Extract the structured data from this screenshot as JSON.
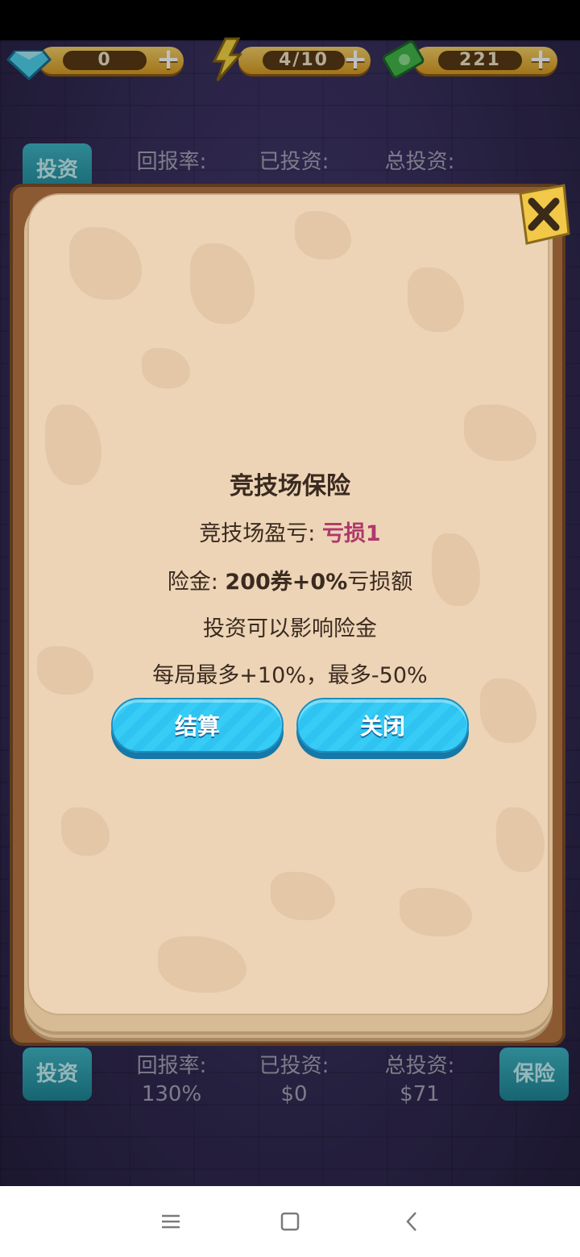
{
  "resources": {
    "gems": "0",
    "energy": "4/10",
    "cash": "221"
  },
  "hud_top": {
    "invest_label": "投资",
    "return_rate_label": "回报率:",
    "invested_label": "已投资:",
    "total_invest_label": "总投资:"
  },
  "hud_bottom": {
    "invest_label": "投资",
    "return_rate_label": "回报率:",
    "return_rate_value": "130%",
    "invested_label": "已投资:",
    "invested_value": "$0",
    "total_invest_label": "总投资:",
    "total_invest_value": "$71",
    "insurance_label": "保险"
  },
  "modal": {
    "title": "竞技场保险",
    "line1_prefix": "竞技场盈亏: ",
    "line1_value": "亏损1",
    "line2_prefix": "险金: ",
    "line2_bold": "200券+0%",
    "line2_suffix": "亏损额",
    "line3": "投资可以影响险金",
    "line4": "每局最多+10%，最多-50%",
    "settle_button": "结算",
    "close_button": "关闭"
  },
  "colors": {
    "loss": "#b0386c",
    "button": "#2ec3f0",
    "page": "#edd4b6"
  }
}
